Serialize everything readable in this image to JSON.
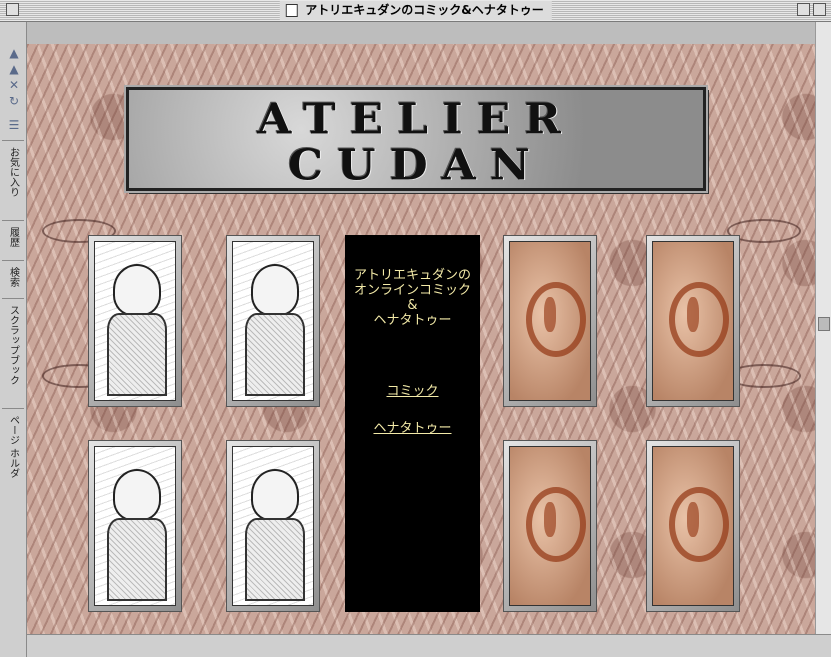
{
  "window": {
    "title": "アトリエキュダンのコミック&ヘナタトゥー"
  },
  "sidebar": {
    "nav_icons": [
      "back-arrow-icon",
      "forward-arrow-icon",
      "stop-icon",
      "reload-icon",
      "menu-icon"
    ],
    "tabs": [
      {
        "label": "お気に入り"
      },
      {
        "label": "履歴"
      },
      {
        "label": "検索"
      },
      {
        "label": "スクラップブック"
      },
      {
        "label": "ページ ホルダ"
      }
    ]
  },
  "page": {
    "logo": {
      "line1": "ATELIER",
      "line2": "CUDAN"
    },
    "center": {
      "heading_line1": "アトリエキュダンの",
      "heading_line2": "オンラインコミック",
      "heading_line3": "&",
      "heading_line4": "ヘナタトゥー",
      "link_comic": "コミック",
      "link_henna": "ヘナタトゥー"
    },
    "link_color": "#f3eaa8",
    "background_color": "#caa79b"
  }
}
